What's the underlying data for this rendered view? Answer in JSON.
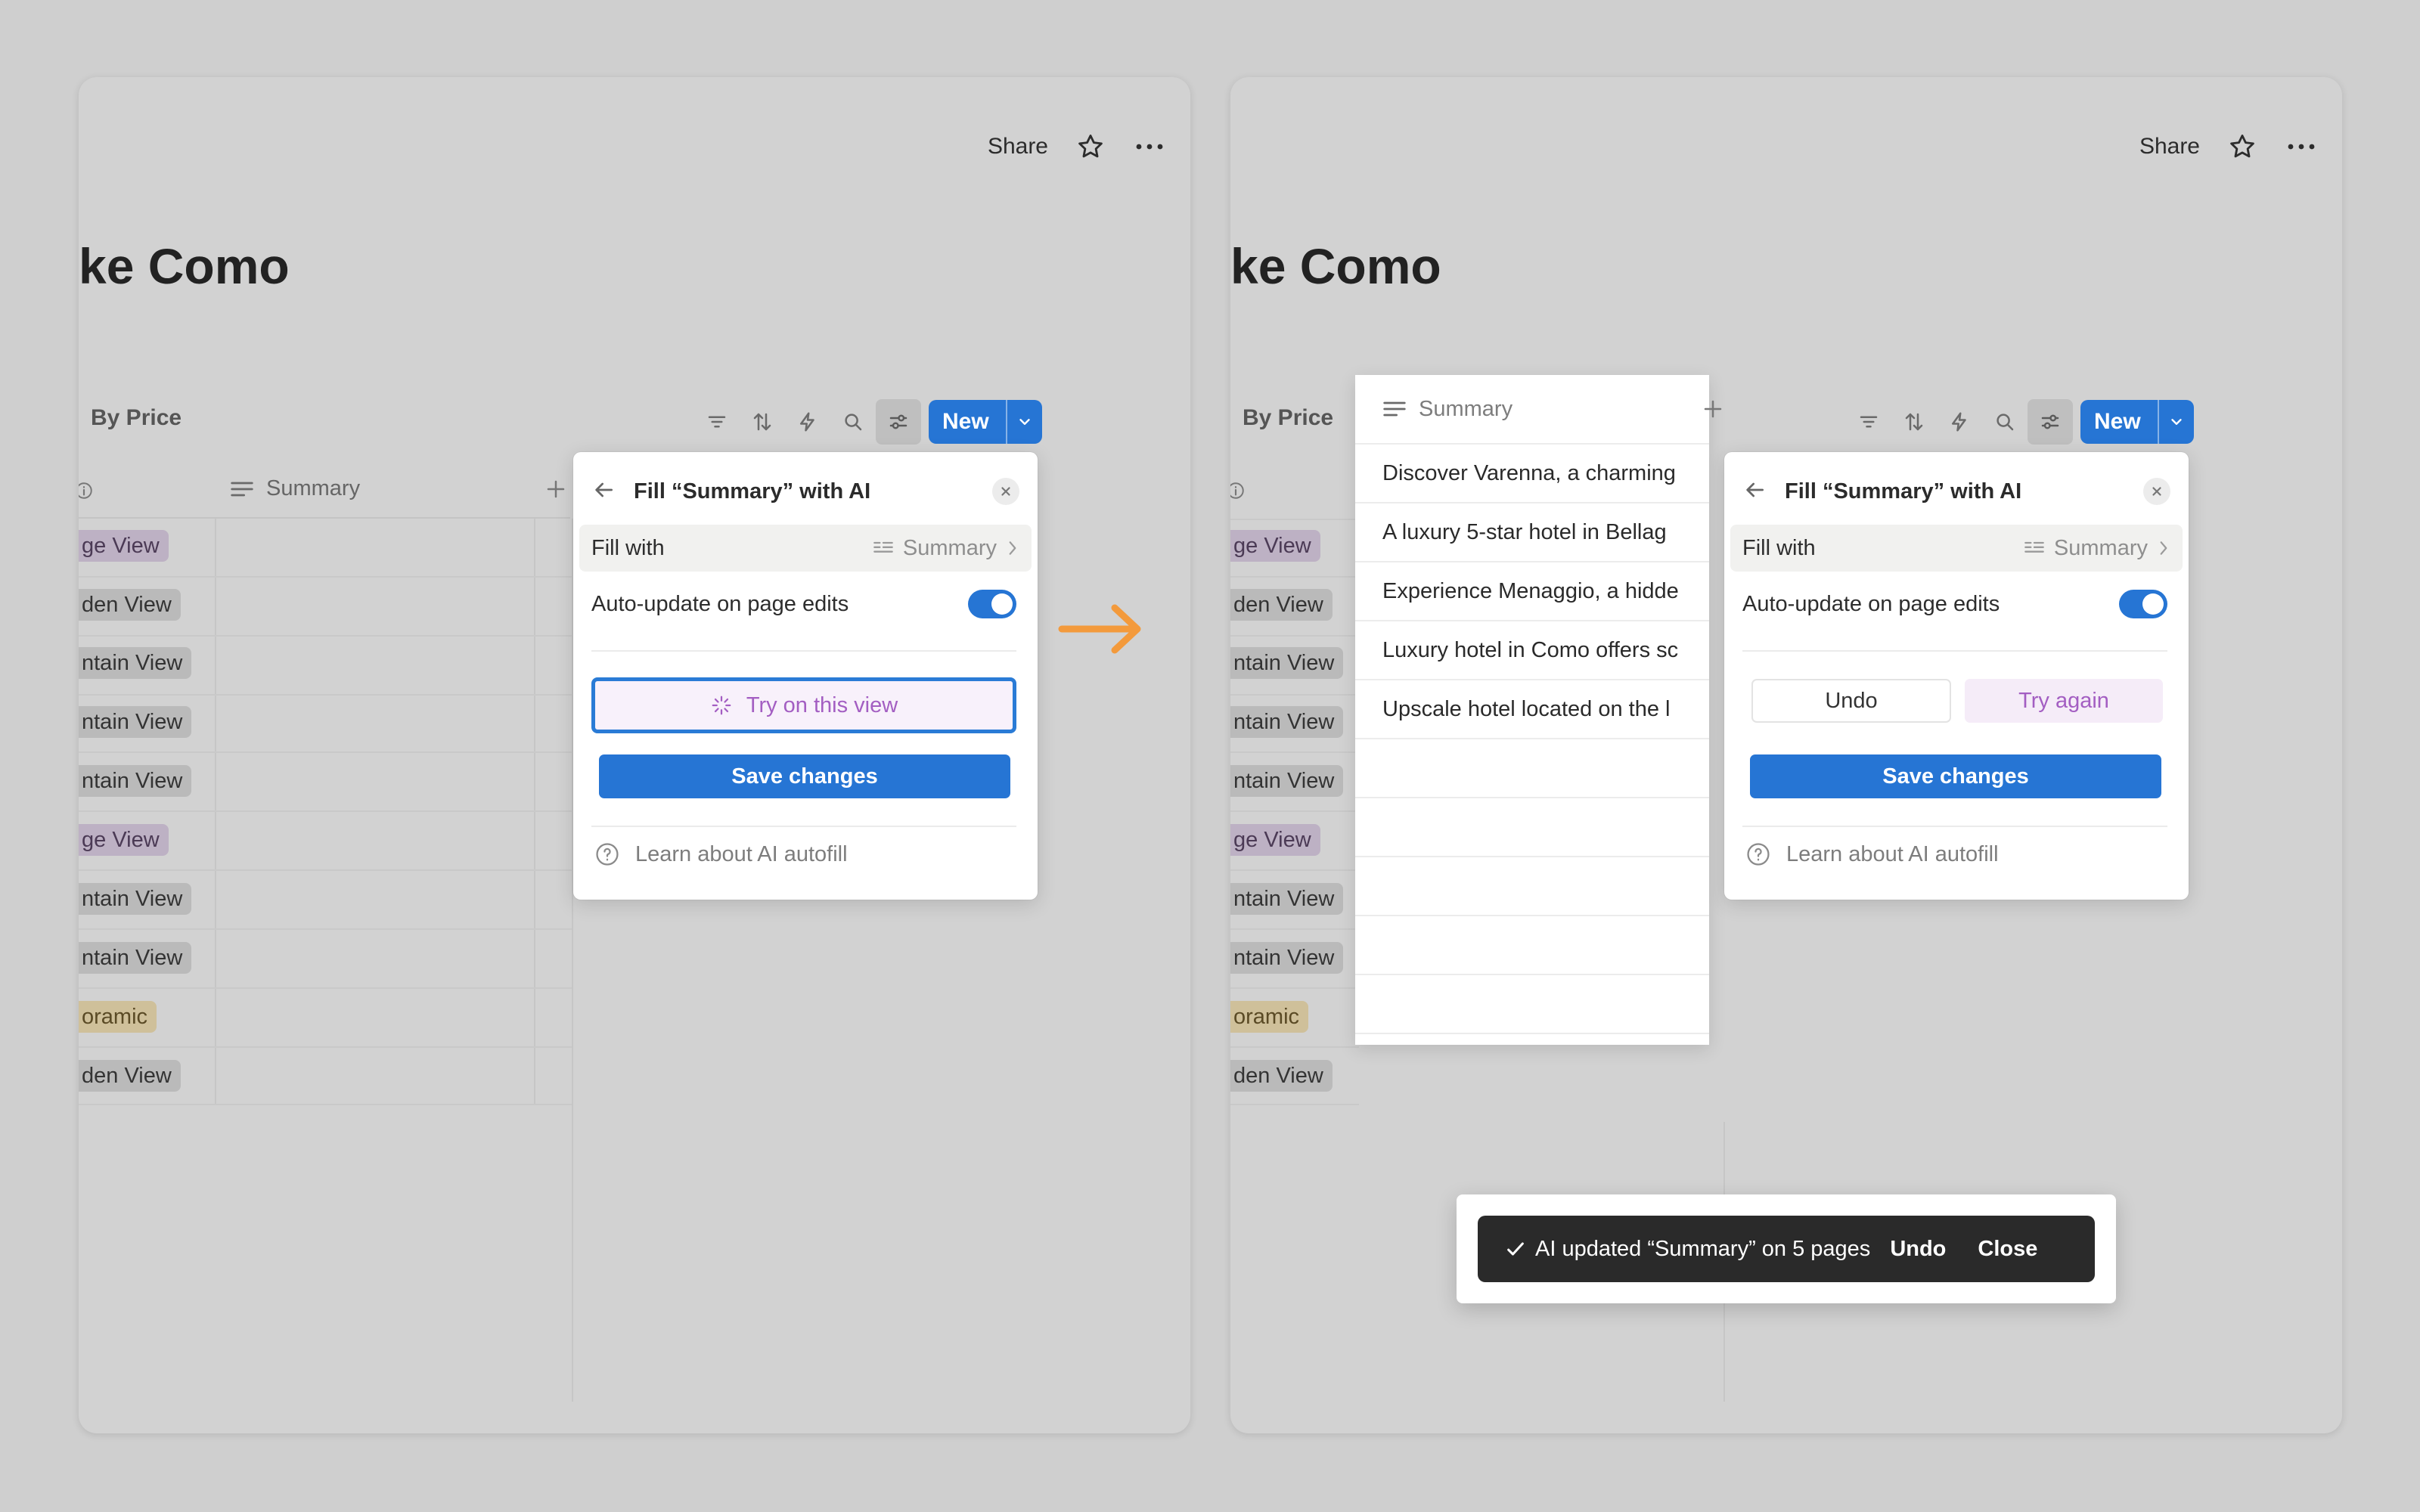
{
  "left": {
    "share_label": "Share",
    "page_title": "ke Como",
    "view_tab": "By Price",
    "new_label": "New",
    "column_summary": "Summary",
    "tags": [
      {
        "text": "ge View",
        "color": "purple"
      },
      {
        "text": "den View",
        "color": "gray"
      },
      {
        "text": "ntain View",
        "color": "gray"
      },
      {
        "text": "ntain View",
        "color": "gray"
      },
      {
        "text": "ntain View",
        "color": "gray"
      },
      {
        "text": "ge View",
        "color": "purple"
      },
      {
        "text": "ntain View",
        "color": "gray"
      },
      {
        "text": "ntain View",
        "color": "gray"
      },
      {
        "text": "oramic",
        "color": "yellow"
      },
      {
        "text": "den View",
        "color": "gray"
      }
    ],
    "popover": {
      "title": "Fill “Summary” with AI",
      "fill_with_label": "Fill with",
      "fill_with_value": "Summary",
      "auto_update_label": "Auto-update on page edits",
      "auto_update_on": true,
      "try_label": "Try on this view",
      "save_label": "Save changes",
      "learn_label": "Learn about AI autofill"
    }
  },
  "right": {
    "share_label": "Share",
    "page_title": "ke Como",
    "view_tab": "By Price",
    "new_label": "New",
    "column_summary": "Summary",
    "tags": [
      {
        "text": "ge View",
        "color": "purple"
      },
      {
        "text": "den View",
        "color": "gray"
      },
      {
        "text": "ntain View",
        "color": "gray"
      },
      {
        "text": "ntain View",
        "color": "gray"
      },
      {
        "text": "ntain View",
        "color": "gray"
      },
      {
        "text": "ge View",
        "color": "purple"
      },
      {
        "text": "ntain View",
        "color": "gray"
      },
      {
        "text": "ntain View",
        "color": "gray"
      },
      {
        "text": "oramic",
        "color": "yellow"
      },
      {
        "text": "den View",
        "color": "gray"
      }
    ],
    "summaries": [
      "Discover Varenna, a charming",
      "A luxury 5-star hotel in Bellag",
      "Experience Menaggio, a hidde",
      "Luxury hotel in Como offers sc",
      "Upscale hotel located on the l"
    ],
    "popover": {
      "title": "Fill “Summary” with AI",
      "fill_with_label": "Fill with",
      "fill_with_value": "Summary",
      "auto_update_label": "Auto-update on page edits",
      "auto_update_on": true,
      "undo_label": "Undo",
      "try_again_label": "Try again",
      "save_label": "Save changes",
      "learn_label": "Learn about AI autofill"
    },
    "toast": {
      "message": "AI updated “Summary” on 5 pages",
      "undo_label": "Undo",
      "close_label": "Close"
    }
  },
  "colors": {
    "accent": "#2675d4",
    "arrow": "#f39a3c",
    "toast_bg": "#2a2a2a",
    "try_text": "#a35ec2"
  }
}
